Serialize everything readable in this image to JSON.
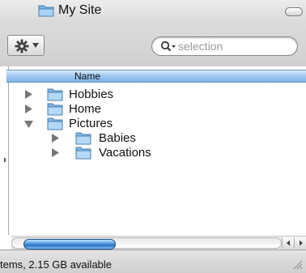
{
  "window": {
    "title": "My Site"
  },
  "toolbar": {
    "action_icon": "gear-icon",
    "search": {
      "placeholder": "selection",
      "icon": "search-icon"
    }
  },
  "list": {
    "columns": [
      "Name"
    ],
    "items": [
      {
        "label": "Hobbies",
        "expanded": false,
        "level": 0
      },
      {
        "label": "Home",
        "expanded": false,
        "level": 0
      },
      {
        "label": "Pictures",
        "expanded": true,
        "level": 0
      },
      {
        "label": "Babies",
        "expanded": false,
        "level": 1
      },
      {
        "label": "Vacations",
        "expanded": false,
        "level": 1
      }
    ]
  },
  "statusbar": {
    "text": "tems, 2.15 GB available"
  },
  "colors": {
    "selection_header": "#98c3ee",
    "scroll_thumb": "#4f96dd",
    "folder": "#8ec2ec"
  }
}
